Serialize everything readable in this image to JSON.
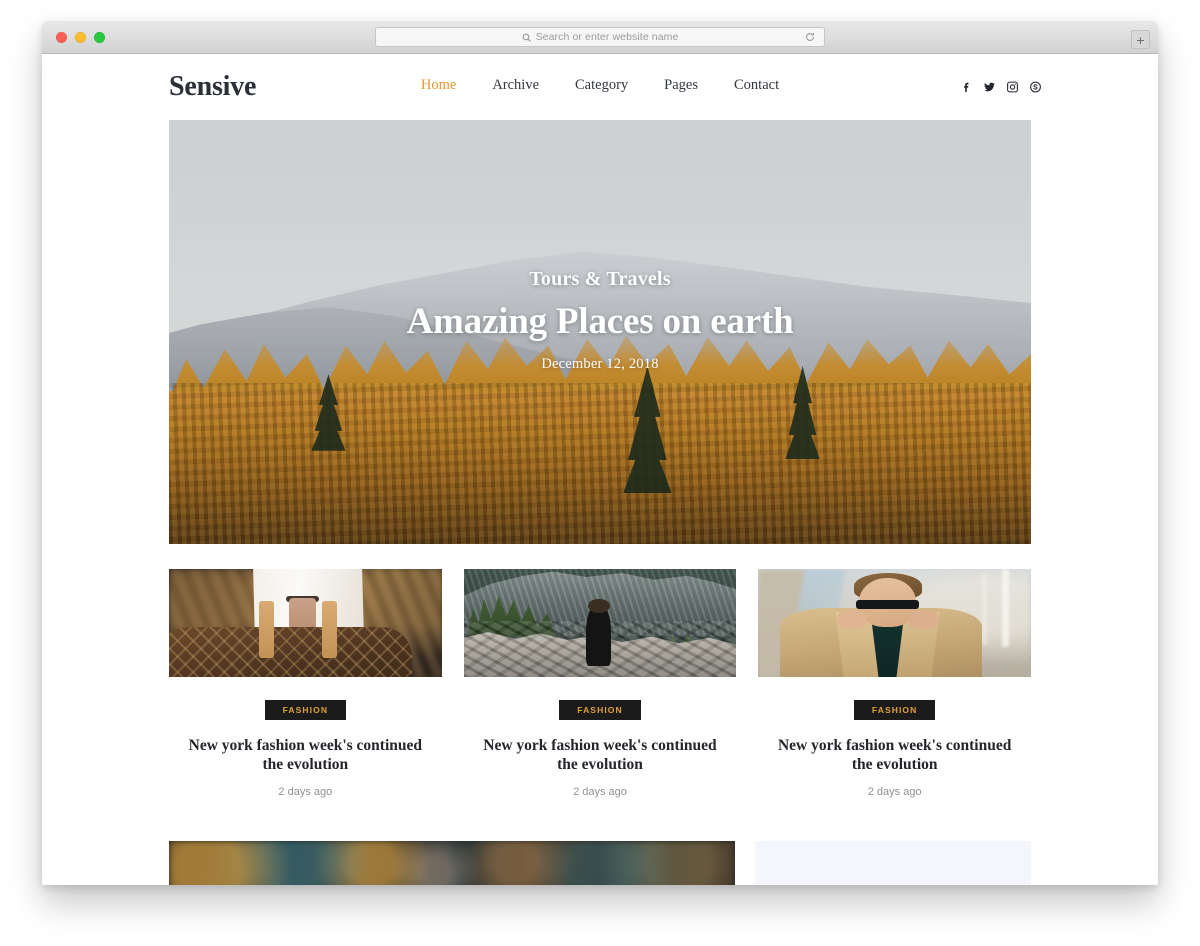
{
  "browser": {
    "url_placeholder": "Search or enter website name",
    "search_icon": "search-icon",
    "reload_icon": "reload-icon",
    "newtab_label": "+",
    "traffic_lights": [
      "close",
      "minimize",
      "maximize"
    ]
  },
  "site": {
    "logo": "Sensive",
    "nav": [
      {
        "label": "Home",
        "active": true
      },
      {
        "label": "Archive",
        "active": false
      },
      {
        "label": "Category",
        "active": false
      },
      {
        "label": "Pages",
        "active": false
      },
      {
        "label": "Contact",
        "active": false
      }
    ],
    "social": [
      {
        "name": "facebook-icon"
      },
      {
        "name": "twitter-icon"
      },
      {
        "name": "instagram-icon"
      },
      {
        "name": "skype-icon"
      }
    ],
    "accent_color": "#e8972e",
    "text_color": "#24262b",
    "badge_bg": "#1b1b1b",
    "badge_color": "#e0a23a"
  },
  "hero": {
    "kicker": "Tours & Travels",
    "title": "Amazing Places on earth",
    "date": "December 12, 2018",
    "image_alt": "snow-capped mountain with autumn larch forest"
  },
  "cards": [
    {
      "badge": "FASHION",
      "title": "New york fashion week's continued the evolution",
      "meta": "2 days ago",
      "image_alt": "person in white coat holding monogram duffel bag"
    },
    {
      "badge": "FASHION",
      "title": "New york fashion week's continued the evolution",
      "meta": "2 days ago",
      "image_alt": "hiker standing on rocky mountain ridge"
    },
    {
      "badge": "FASHION",
      "title": "New york fashion week's continued the evolution",
      "meta": "2 days ago",
      "image_alt": "man in tan coat wearing sunglasses"
    }
  ],
  "bottom": {
    "wide_image_alt": "dark bokeh night scene",
    "side_block_alt": "light placeholder block"
  }
}
